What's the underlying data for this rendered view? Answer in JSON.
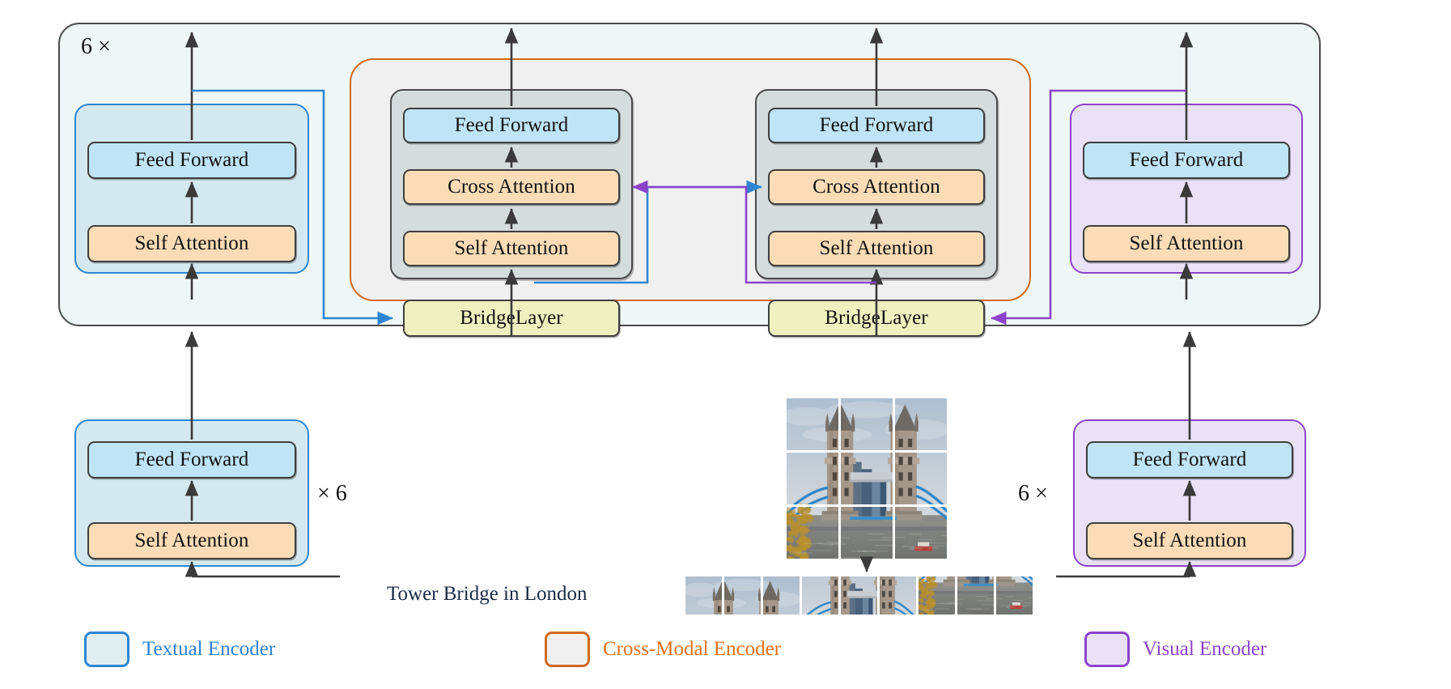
{
  "diagram": {
    "title": "BridgeTower vision-language encoder architecture",
    "outer_block": {
      "repeat_label": "6 ×"
    },
    "textual_encoder_top": {
      "blocks": [
        {
          "id": "ff",
          "label": "Feed Forward"
        },
        {
          "id": "sa",
          "label": "Self Attention"
        }
      ]
    },
    "visual_encoder_top": {
      "blocks": [
        {
          "id": "ff",
          "label": "Feed Forward"
        },
        {
          "id": "sa",
          "label": "Self Attention"
        }
      ]
    },
    "cross_modal_encoder": {
      "text_column": {
        "name": "text-cross-modal-column",
        "blocks": [
          {
            "id": "ff",
            "label": "Feed Forward"
          },
          {
            "id": "ca",
            "label": "Cross Attention"
          },
          {
            "id": "sa",
            "label": "Self Attention"
          }
        ],
        "bridge": "BridgeLayer"
      },
      "vision_column": {
        "name": "vision-cross-modal-column",
        "blocks": [
          {
            "id": "ff",
            "label": "Feed Forward"
          },
          {
            "id": "ca",
            "label": "Cross Attention"
          },
          {
            "id": "sa",
            "label": "Self Attention"
          }
        ],
        "bridge": "BridgeLayer"
      }
    },
    "textual_encoder_bottom": {
      "repeat_label": "× 6",
      "blocks": [
        {
          "id": "ff",
          "label": "Feed Forward"
        },
        {
          "id": "sa",
          "label": "Self Attention"
        }
      ]
    },
    "visual_encoder_bottom": {
      "repeat_label": "6 ×",
      "blocks": [
        {
          "id": "ff",
          "label": "Feed Forward"
        },
        {
          "id": "sa",
          "label": "Self Attention"
        }
      ]
    },
    "inputs": {
      "text_caption": "Tower Bridge in London",
      "image_grid_alt": "tower-bridge-photo-3x3-patch-grid",
      "image_strip_alt": "tower-bridge-flattened-patch-sequence",
      "patch_count": 9
    },
    "legend": [
      {
        "name": "legend-textual-encoder",
        "label": "Textual Encoder",
        "border": "#2d86d2",
        "fill": "#e1eef1",
        "text": "#2d7fd2"
      },
      {
        "name": "legend-cross-modal-encoder",
        "label": "Cross-Modal Encoder",
        "border": "#cf6a21",
        "fill": "#f0f0f0",
        "text": "#e2711d"
      },
      {
        "name": "legend-visual-encoder",
        "label": "Visual Encoder",
        "border": "#8b44c9",
        "fill": "#e9e2f7",
        "text": "#8b44c9"
      }
    ],
    "colors": {
      "feed_forward": "#bfe4f6",
      "attention": "#fbdcb6",
      "bridge_layer": "#eff0c0",
      "textual_border": "#2d86d2",
      "visual_border": "#8b44c9",
      "cross_modal_border": "#cf6a21",
      "outer_background": "#eef7f5",
      "arrow": "#3a3a3a"
    }
  }
}
